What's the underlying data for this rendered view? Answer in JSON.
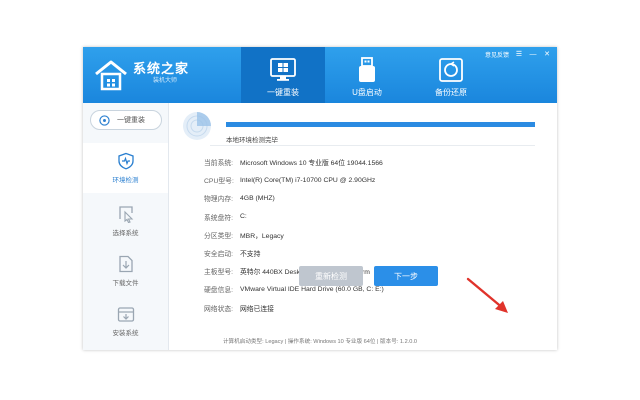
{
  "app": {
    "name": "系统之家",
    "subtitle": "装机大师",
    "feedback_label": "意见反馈",
    "window_buttons": [
      "menu-icon",
      "minimize-icon",
      "close-icon"
    ]
  },
  "tabs": [
    {
      "label": "一键重装",
      "icon": "windows-monitor-icon",
      "active": true
    },
    {
      "label": "U盘启动",
      "icon": "usb-drive-icon",
      "active": false
    },
    {
      "label": "备份还原",
      "icon": "backup-restore-icon",
      "active": false
    }
  ],
  "sidebar": {
    "reinstall_label": "一键重装",
    "items": [
      {
        "label": "环境检测",
        "icon": "shield-heart-icon",
        "active": true
      },
      {
        "label": "选择系统",
        "icon": "cursor-select-icon",
        "active": false
      },
      {
        "label": "下载文件",
        "icon": "file-download-icon",
        "active": false
      },
      {
        "label": "安装系统",
        "icon": "install-tray-icon",
        "active": false
      }
    ]
  },
  "detection": {
    "progress_percent": 100,
    "status_text": "本地环境检测完毕"
  },
  "info": [
    {
      "label": "当前系统:",
      "value": "Microsoft Windows 10 专业版 64位 19044.1566"
    },
    {
      "label": "CPU型号:",
      "value": "Intel(R) Core(TM) i7-10700 CPU @ 2.90GHz"
    },
    {
      "label": "物理内存:",
      "value": "4GB (MHZ)"
    },
    {
      "label": "系统盘符:",
      "value": "C:"
    },
    {
      "label": "分区类型:",
      "value": "MBR，Legacy"
    },
    {
      "label": "安全启动:",
      "value": "不支持"
    },
    {
      "label": "主板型号:",
      "value": "英特尔 440BX Desktop Reference Platform"
    },
    {
      "label": "硬盘信息:",
      "value": "VMware Virtual IDE Hard Drive  (60.0 GB, C: E:)"
    },
    {
      "label": "网络状态:",
      "value": "网络已连接"
    }
  ],
  "buttons": {
    "redetect": "重新检测",
    "next": "下一步"
  },
  "footer": {
    "text": "计算机启动类型:  Legacy | 操作系统:  Windows 10 专业版 64位 | 版本号:  1.2.0.0"
  },
  "colors": {
    "header": "#1a86dd",
    "active_tab": "#1172c6",
    "primary_button": "#2b8fe8",
    "disabled_button": "#bfc6cf",
    "annotation_arrow": "#e0332b"
  }
}
